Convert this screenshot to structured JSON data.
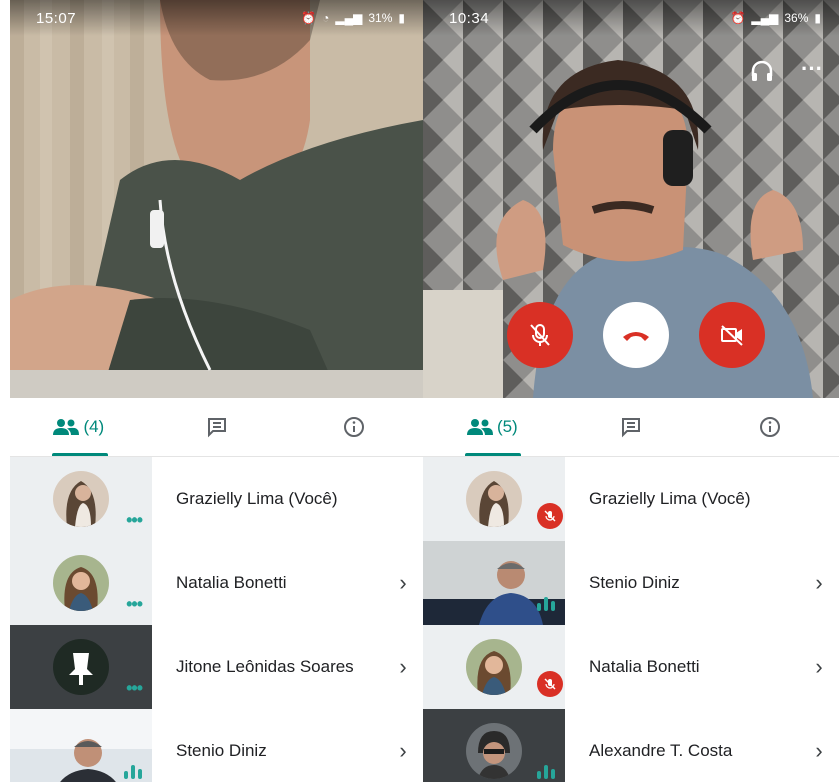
{
  "left": {
    "status": {
      "time": "15:07",
      "battery": "31%"
    },
    "tabs": {
      "people_count": "(4)"
    },
    "participants": [
      {
        "name": "Grazielly Lima (Você)"
      },
      {
        "name": "Natalia Bonetti"
      },
      {
        "name": "Jitone Leônidas Soares"
      },
      {
        "name": "Stenio Diniz"
      }
    ]
  },
  "right": {
    "status": {
      "time": "10:34",
      "battery": "36%"
    },
    "tabs": {
      "people_count": "(5)"
    },
    "participants": [
      {
        "name": "Grazielly Lima (Você)"
      },
      {
        "name": "Stenio Diniz"
      },
      {
        "name": "Natalia Bonetti"
      },
      {
        "name": "Alexandre T. Costa"
      }
    ]
  },
  "icons": {
    "people": "people-icon",
    "chat": "chat-icon",
    "info": "info-icon",
    "headphones": "headphones-icon",
    "more": "more-horiz-icon",
    "mic_off": "mic-off-icon",
    "hang_up": "hang-up-icon",
    "video_off": "video-off-icon",
    "chevron": "chevron-right-icon"
  },
  "colors": {
    "accent": "#00897b",
    "end_call": "#d93025",
    "mute_badge": "#d93025"
  }
}
